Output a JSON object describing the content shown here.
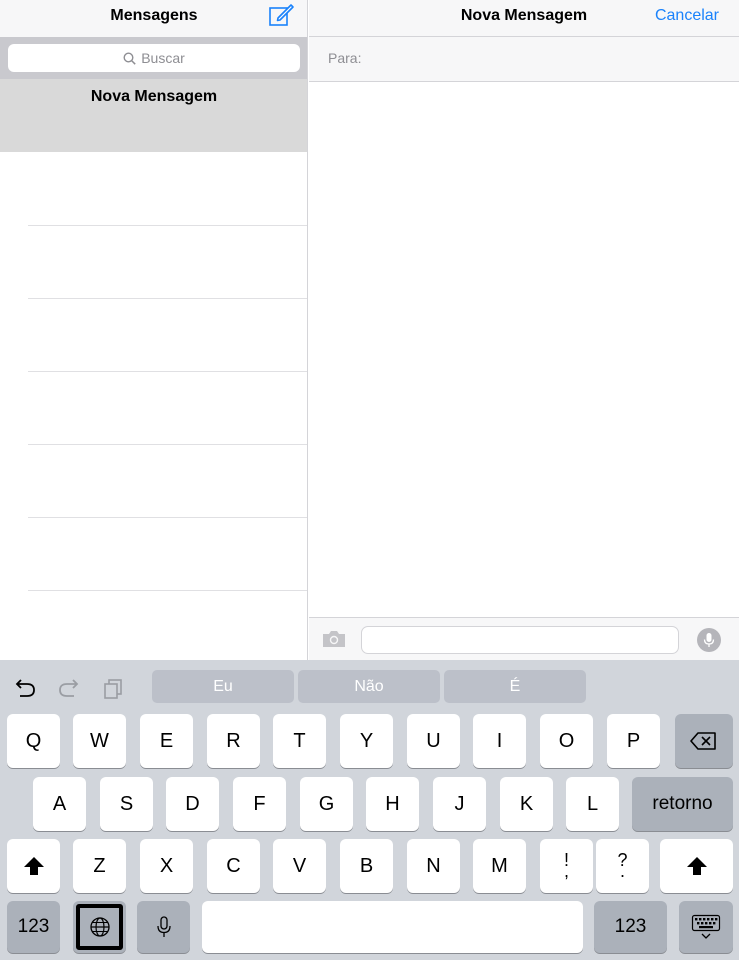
{
  "sidebar": {
    "title": "Mensagens",
    "compose_icon": "compose-icon",
    "search_placeholder": "Buscar",
    "selected_conversation": "Nova Mensagem"
  },
  "detail": {
    "title": "Nova Mensagem",
    "cancel_label": "Cancelar",
    "to_label": "Para:"
  },
  "keyboard": {
    "suggestions": [
      "Eu",
      "Não",
      "É"
    ],
    "row1": [
      "Q",
      "W",
      "E",
      "R",
      "T",
      "Y",
      "U",
      "I",
      "O",
      "P"
    ],
    "row2": [
      "A",
      "S",
      "D",
      "F",
      "G",
      "H",
      "J",
      "K",
      "L"
    ],
    "row3": [
      "Z",
      "X",
      "C",
      "V",
      "B",
      "N",
      "M"
    ],
    "exclam_top": "!",
    "exclam_bottom": ",",
    "question_top": "?",
    "question_bottom": ".",
    "return_label": "retorno",
    "numbers_label": "123"
  },
  "colors": {
    "accent": "#1a82fb",
    "keyboard_bg": "#d1d5db",
    "selected_row": "#d9d9d9"
  }
}
